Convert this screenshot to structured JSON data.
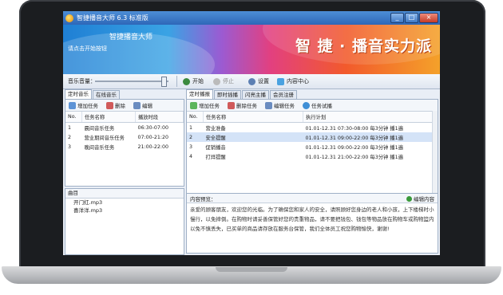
{
  "window": {
    "title": "智捷播音大师 6.3 标准版",
    "minimize": "_",
    "maximize": "□",
    "close": "×"
  },
  "banner": {
    "app_name": "智捷播音大师",
    "hint": "请点击开始按钮",
    "slogan": "智 捷 · 播音实力派"
  },
  "toolbar": {
    "volume_label": "音乐音量：",
    "volume_level": 0.93,
    "start": "开始",
    "stop": "停止",
    "settings": "设置",
    "content_center": "内容中心"
  },
  "left_panel": {
    "tabs": [
      "定时音乐",
      "在线音乐"
    ],
    "active_tab": 0,
    "actions": [
      "增加任务",
      "删除",
      "编辑"
    ],
    "columns": [
      "No.",
      "任务名称",
      "播放时段"
    ],
    "rows": [
      {
        "no": "1",
        "name": "晨间音乐任务",
        "period": "06:30-07:00"
      },
      {
        "no": "2",
        "name": "营业期间音乐任务",
        "period": "07:00-21:20"
      },
      {
        "no": "3",
        "name": "晚间音乐任务",
        "period": "21:00-22:00"
      }
    ],
    "songs_label": "曲目",
    "songs": [
      "开门红.mp3",
      "喜洋洋.mp3"
    ]
  },
  "right_panel": {
    "tabs": [
      "定时播报",
      "即时插播",
      "闪亮主播",
      "会员注册"
    ],
    "active_tab": 0,
    "actions": [
      "增加任务",
      "删除任务",
      "编辑任务",
      "任务试播"
    ],
    "columns": [
      "No.",
      "任务名称",
      "执行计划"
    ],
    "rows": [
      {
        "no": "1",
        "name": "营业准备",
        "plan": "01.01-12.31 07:30-08:00 每3分钟 播1遍"
      },
      {
        "no": "2",
        "name": "安全提醒",
        "plan": "01.01-12.31 09:00-22:00 每3分钟 播1遍"
      },
      {
        "no": "3",
        "name": "促销播音",
        "plan": "01.01-12.31 09:00-22:00 每3分钟 播1遍"
      },
      {
        "no": "4",
        "name": "打烊提醒",
        "plan": "01.01-12.31 21:00-22:00 每3分钟 播1遍"
      }
    ],
    "selected_row": 1,
    "preview_label": "内容预览：",
    "edit_content": "编辑内容",
    "preview_lines": [
      "亲爱的顾客朋友，欢迎您的光临。为了确保您和家人的安全，请照顾好您身边的老人和小孩，上下楼梯时小心",
      "慢行，以免摔倒。在购物时请妥善保管好您的贵重物品，请不要把钱包、钱包等物品放在购物车或购物篮内，",
      "以免不慎丢失，已买单的商品请存放在服务台保管，我们全体员工祝您购物愉快，谢谢!"
    ]
  },
  "colors": {
    "titlebar": "#2e67b8",
    "selection": "#d4e3f7",
    "panel_border": "#9fb0c6"
  }
}
